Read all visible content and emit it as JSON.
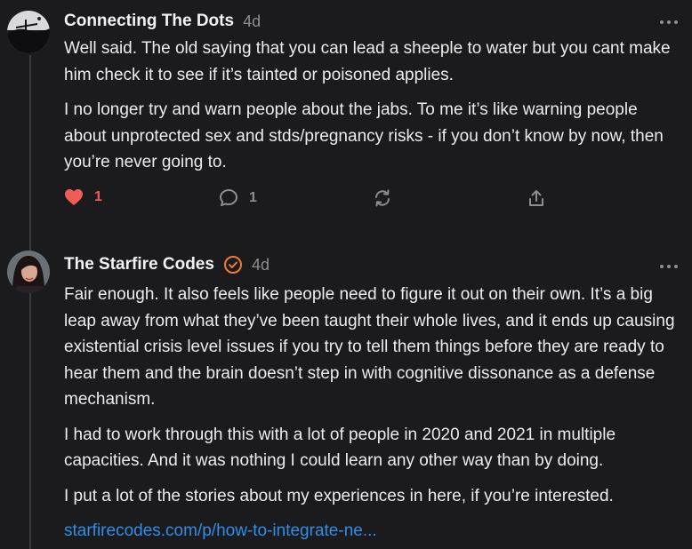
{
  "comments": [
    {
      "author": "Connecting The Dots",
      "time": "4d",
      "paragraphs": [
        "Well said. The old saying that you can lead a sheeple to water but you cant make him check it to see if it’s tainted or poisoned applies.",
        "I no longer try and warn people about the jabs. To me it’s like warning people about unprotected sex and stds/pregnancy risks - if you don’t know by now, then you’re never going to."
      ],
      "likes": "1",
      "replies": "1",
      "icons": [
        "heart-icon",
        "reply-bubble-icon",
        "restack-icon",
        "share-icon",
        "more-icon"
      ]
    },
    {
      "author": "The Starfire Codes",
      "time": "4d",
      "verified": true,
      "paragraphs": [
        "Fair enough. It also feels like people need to figure it out on their own. It’s a big leap away from what they’ve been taught their whole lives, and it ends up causing existential crisis level issues if you try to tell them things before they are ready to hear them and the brain doesn’t step in with cognitive dissonance as a defense mechanism.",
        "I had to work through this with a lot of people in 2020 and 2021 in multiple capacities. And it was nothing I could learn any other way than by doing.",
        "I put a lot of the stories about my experiences in here, if you’re interested."
      ],
      "link": "starfirecodes.com/p/how-to-integrate-ne...",
      "icons": [
        "verified-check-icon",
        "more-icon"
      ]
    }
  ],
  "colors": {
    "background": "#1b1b1d",
    "text": "#ececec",
    "muted": "#8d8d93",
    "like": "#ee5d57",
    "link": "#2f8fe8",
    "verified": "#f07b32"
  }
}
